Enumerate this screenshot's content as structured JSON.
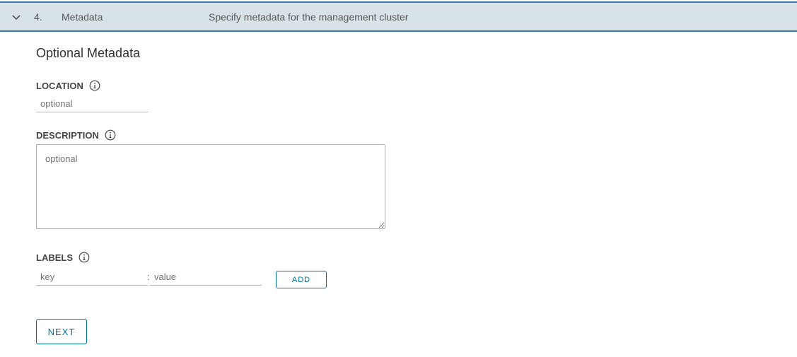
{
  "step": {
    "number": "4.",
    "title": "Metadata",
    "description": "Specify metadata for the management cluster"
  },
  "section_title": "Optional Metadata",
  "location": {
    "label": "LOCATION",
    "placeholder": "optional"
  },
  "description": {
    "label": "DESCRIPTION",
    "placeholder": "optional"
  },
  "labels": {
    "label": "LABELS",
    "key_placeholder": "key",
    "separator": ":",
    "value_placeholder": "value",
    "add_label": "ADD"
  },
  "next_label": "NEXT",
  "colors": {
    "header_bg": "#d8e3e9",
    "header_border": "#3b74b2",
    "button_accent": "#0072a3"
  },
  "icons": {
    "chevron": "chevron-down-icon",
    "info": "info-circle-icon"
  }
}
